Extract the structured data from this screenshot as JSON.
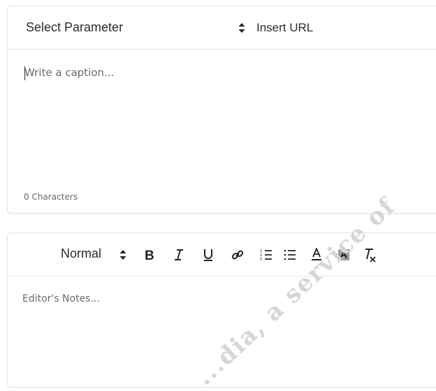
{
  "caption_editor": {
    "parameter_select": {
      "selected": "Select Parameter"
    },
    "url_input": {
      "placeholder": "Insert URL"
    },
    "caption": {
      "placeholder": "Write a caption..."
    },
    "char_count": "0 Characters"
  },
  "notes_editor": {
    "toolbar": {
      "format_select": "Normal",
      "buttons": [
        "bold",
        "italic",
        "underline",
        "link",
        "ordered-list",
        "bullet-list",
        "font-color",
        "background-color",
        "clear-format"
      ]
    },
    "notes": {
      "placeholder": "Editor's Notes..."
    }
  },
  "watermark": {
    "text": "...dia, a service of"
  },
  "colors": {
    "border": "#e3e3e3",
    "text": "#2b2b2b",
    "placeholder": "#6b6b6b"
  }
}
